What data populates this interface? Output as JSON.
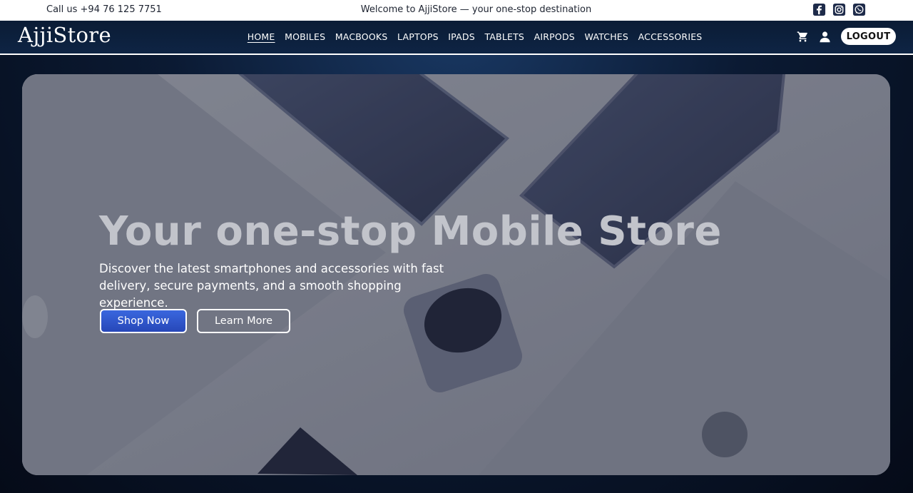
{
  "topbar": {
    "call": "Call us +94 76 125 7751",
    "welcome": "Welcome to AjjiStore — your one-stop destination",
    "social": [
      "facebook-icon",
      "instagram-icon",
      "whatsapp-icon"
    ]
  },
  "nav": {
    "logo": "AjjiStore",
    "items": [
      "HOME",
      "MOBILES",
      "MACBOOKS",
      "LAPTOPS",
      "IPADS",
      "TABLETS",
      "AIRPODS",
      "WATCHES",
      "ACCESSORIES"
    ],
    "active": "HOME",
    "logout": "LOGOUT"
  },
  "hero": {
    "title": "Your one-stop Mobile Store",
    "subtitle": "Discover the latest smartphones and accessories with fast delivery, secure payments, and a smooth shopping experience.",
    "primary": "Shop Now",
    "secondary": "Learn More"
  },
  "colors": {
    "navy": "#0e2444",
    "primary": "#3358d6",
    "white": "#ffffff"
  }
}
